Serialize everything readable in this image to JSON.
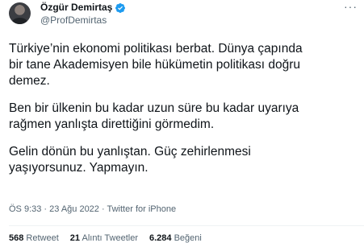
{
  "author": {
    "name": "Özgür Demirtaş",
    "handle": "@ProfDemirtas",
    "verified_color": "#1d9bf0"
  },
  "more_label": "···",
  "tweet": {
    "paragraphs": [
      "Türkiye’nin ekonomi politikası berbat. Dünya çapında\nbir tane Akademisyen bile hükümetin politikası doğru\ndemez.",
      "Ben bir ülkenin bu kadar uzun süre bu kadar uyarıya\nrağmen yanlışta direttiğini görmedim.",
      "Gelin dönün bu yanlıştan. Güç zehirlenmesi\nyaşıyorsunuz. Yapmayın."
    ],
    "meta": "ÖS 9:33 · 23 Ağu 2022 · Twitter for iPhone"
  },
  "stats": {
    "retweets_count": "568",
    "retweets_label": "Retweet",
    "quotes_count": "21",
    "quotes_label": "Alıntı Tweetler",
    "likes_count": "6.284",
    "likes_label": "Beğeni"
  }
}
